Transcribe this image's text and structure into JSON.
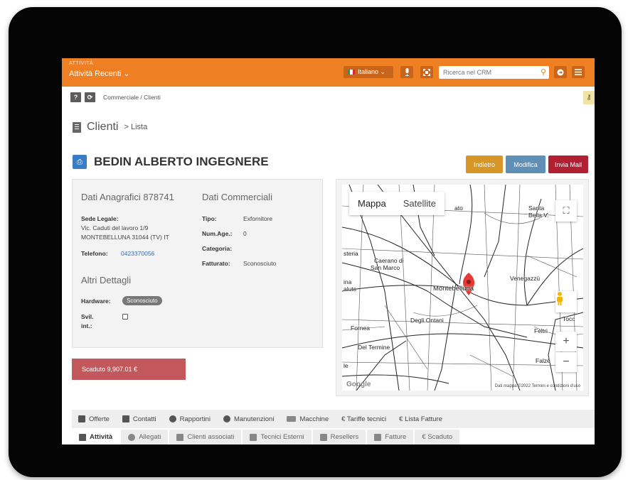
{
  "header": {
    "section_label": "ATTIVITÀ",
    "section_dropdown": "Attività Recenti ⌄",
    "language": "Italiano ⌄",
    "search_placeholder": "Ricerca nel CRM"
  },
  "breadcrumb": {
    "items": "Commerciale / Clienti"
  },
  "page": {
    "title": "Clienti",
    "subtitle": "> Lista"
  },
  "client": {
    "name": "BEDIN ALBERTO INGEGNERE"
  },
  "actions": {
    "back": "Indietro",
    "edit": "Modifica",
    "mail": "Invia Mail"
  },
  "anagrafici": {
    "title": "Dati Anagrafici 878741",
    "sede_label": "Sede Legale:",
    "address1": "Vic. Caduti del lavoro 1/9",
    "address2": "MONTEBELLUNA 31044 (TV) IT",
    "phone_label": "Telefono:",
    "phone": "0423370056"
  },
  "commerciali": {
    "title": "Dati Commerciali",
    "tipo_label": "Tipo:",
    "tipo": "Exfornitore",
    "numage_label": "Num.Age.:",
    "numage": "0",
    "categoria_label": "Categoria:",
    "fatturato_label": "Fatturato:",
    "fatturato": "Sconosciuto"
  },
  "dettagli": {
    "title": "Altri Dettagli",
    "hardware_label": "Hardware:",
    "hardware": "Sconosciuto",
    "svil_label": "Svil.",
    "svil_label2": "int.:"
  },
  "due": {
    "text": "Scaduto 9,907.01 €"
  },
  "map": {
    "tab_map": "Mappa",
    "tab_sat": "Satellite",
    "labels": {
      "montebelluna": "Montebelluna",
      "caerano": "Caerano di",
      "caerano2": "San Marco",
      "degli_ontani": "Degli Ontani",
      "venegazzu": "Venegazzù",
      "fornea": "Fornea",
      "del_termine": "Del Termine",
      "santa": "Santa",
      "bella": "Bella V.",
      "feltrina": "Feltri",
      "falze": "Falzè",
      "tocc": "Tocc",
      "steria": "steria",
      "ina": "ina",
      "alute": "alute",
      "ato": "ato",
      "le": "le"
    },
    "footer": "Dati mappa ©2022   Termini e condizioni d'uso",
    "google": "Google"
  },
  "tabs_row1": [
    "Offerte",
    "Contatti",
    "Rapportini",
    "Manutenzioni",
    "Macchine",
    "€  Tariffe tecnici",
    "€  Lista Fatture"
  ],
  "tabs_row2": [
    "Attività",
    "Allegati",
    "Clienti associati",
    "Tecnici Esterni",
    "Resellers",
    "Fatture",
    "€  Scaduto"
  ],
  "colors": {
    "header": "#ef7f23",
    "back_btn": "#d69628",
    "edit_btn": "#5f8fb4",
    "mail_btn": "#b21f33",
    "due": "#c2585c",
    "pdf": "#3b7dc4"
  },
  "icons": {
    "flag": "italy-flag-icon",
    "mic": "microphone-icon",
    "expand": "expand-icon",
    "search": "search-icon",
    "logout": "logout-icon",
    "menu": "hamburger-menu-icon"
  }
}
